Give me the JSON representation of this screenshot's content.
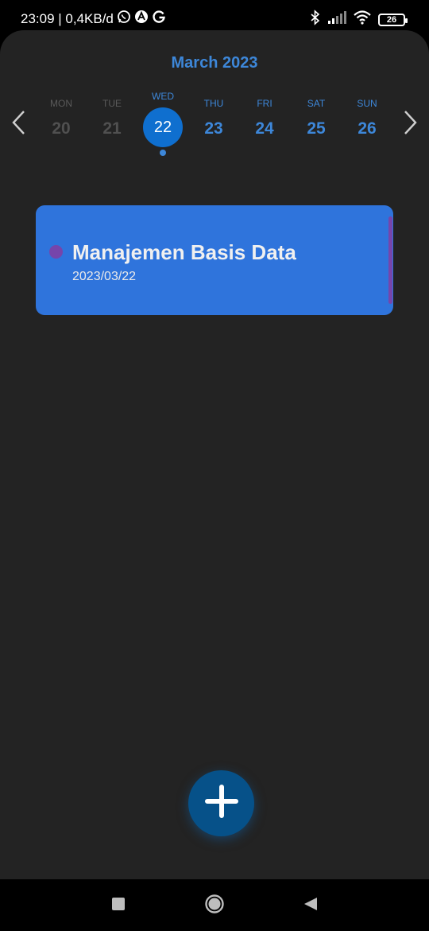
{
  "status": {
    "time_info": "23:09 | 0,4KB/d",
    "battery": "26"
  },
  "calendar": {
    "month_title": "March 2023",
    "days": [
      {
        "name": "MON",
        "num": "20"
      },
      {
        "name": "TUE",
        "num": "21"
      },
      {
        "name": "WED",
        "num": "22"
      },
      {
        "name": "THU",
        "num": "23"
      },
      {
        "name": "FRI",
        "num": "24"
      },
      {
        "name": "SAT",
        "num": "25"
      },
      {
        "name": "SUN",
        "num": "26"
      }
    ]
  },
  "task": {
    "title": "Manajemen Basis Data",
    "date": "2023/03/22"
  },
  "colors": {
    "accent": "#3d87d9",
    "selected": "#0f6fcf",
    "card": "#2f74dc",
    "task_marker": "#7645ab",
    "fab": "#065189",
    "background": "#232323"
  },
  "icons": {
    "status": [
      "whatsapp-icon",
      "app-icon",
      "google-icon",
      "bluetooth-icon",
      "signal-icon",
      "wifi-icon",
      "battery-icon"
    ],
    "navigation": [
      "chevron-left-icon",
      "chevron-right-icon",
      "plus-icon",
      "recents-icon",
      "home-icon",
      "back-icon"
    ]
  }
}
